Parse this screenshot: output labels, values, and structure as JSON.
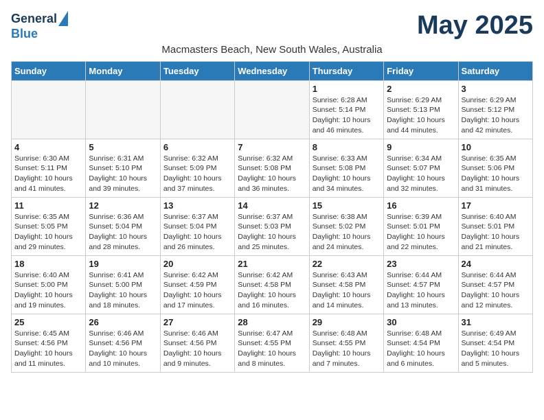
{
  "header": {
    "logo_line1": "General",
    "logo_line2": "Blue",
    "month": "May 2025",
    "subtitle": "Macmasters Beach, New South Wales, Australia"
  },
  "weekdays": [
    "Sunday",
    "Monday",
    "Tuesday",
    "Wednesday",
    "Thursday",
    "Friday",
    "Saturday"
  ],
  "weeks": [
    [
      {
        "day": "",
        "info": ""
      },
      {
        "day": "",
        "info": ""
      },
      {
        "day": "",
        "info": ""
      },
      {
        "day": "",
        "info": ""
      },
      {
        "day": "1",
        "info": "Sunrise: 6:28 AM\nSunset: 5:14 PM\nDaylight: 10 hours\nand 46 minutes."
      },
      {
        "day": "2",
        "info": "Sunrise: 6:29 AM\nSunset: 5:13 PM\nDaylight: 10 hours\nand 44 minutes."
      },
      {
        "day": "3",
        "info": "Sunrise: 6:29 AM\nSunset: 5:12 PM\nDaylight: 10 hours\nand 42 minutes."
      }
    ],
    [
      {
        "day": "4",
        "info": "Sunrise: 6:30 AM\nSunset: 5:11 PM\nDaylight: 10 hours\nand 41 minutes."
      },
      {
        "day": "5",
        "info": "Sunrise: 6:31 AM\nSunset: 5:10 PM\nDaylight: 10 hours\nand 39 minutes."
      },
      {
        "day": "6",
        "info": "Sunrise: 6:32 AM\nSunset: 5:09 PM\nDaylight: 10 hours\nand 37 minutes."
      },
      {
        "day": "7",
        "info": "Sunrise: 6:32 AM\nSunset: 5:08 PM\nDaylight: 10 hours\nand 36 minutes."
      },
      {
        "day": "8",
        "info": "Sunrise: 6:33 AM\nSunset: 5:08 PM\nDaylight: 10 hours\nand 34 minutes."
      },
      {
        "day": "9",
        "info": "Sunrise: 6:34 AM\nSunset: 5:07 PM\nDaylight: 10 hours\nand 32 minutes."
      },
      {
        "day": "10",
        "info": "Sunrise: 6:35 AM\nSunset: 5:06 PM\nDaylight: 10 hours\nand 31 minutes."
      }
    ],
    [
      {
        "day": "11",
        "info": "Sunrise: 6:35 AM\nSunset: 5:05 PM\nDaylight: 10 hours\nand 29 minutes."
      },
      {
        "day": "12",
        "info": "Sunrise: 6:36 AM\nSunset: 5:04 PM\nDaylight: 10 hours\nand 28 minutes."
      },
      {
        "day": "13",
        "info": "Sunrise: 6:37 AM\nSunset: 5:04 PM\nDaylight: 10 hours\nand 26 minutes."
      },
      {
        "day": "14",
        "info": "Sunrise: 6:37 AM\nSunset: 5:03 PM\nDaylight: 10 hours\nand 25 minutes."
      },
      {
        "day": "15",
        "info": "Sunrise: 6:38 AM\nSunset: 5:02 PM\nDaylight: 10 hours\nand 24 minutes."
      },
      {
        "day": "16",
        "info": "Sunrise: 6:39 AM\nSunset: 5:01 PM\nDaylight: 10 hours\nand 22 minutes."
      },
      {
        "day": "17",
        "info": "Sunrise: 6:40 AM\nSunset: 5:01 PM\nDaylight: 10 hours\nand 21 minutes."
      }
    ],
    [
      {
        "day": "18",
        "info": "Sunrise: 6:40 AM\nSunset: 5:00 PM\nDaylight: 10 hours\nand 19 minutes."
      },
      {
        "day": "19",
        "info": "Sunrise: 6:41 AM\nSunset: 5:00 PM\nDaylight: 10 hours\nand 18 minutes."
      },
      {
        "day": "20",
        "info": "Sunrise: 6:42 AM\nSunset: 4:59 PM\nDaylight: 10 hours\nand 17 minutes."
      },
      {
        "day": "21",
        "info": "Sunrise: 6:42 AM\nSunset: 4:58 PM\nDaylight: 10 hours\nand 16 minutes."
      },
      {
        "day": "22",
        "info": "Sunrise: 6:43 AM\nSunset: 4:58 PM\nDaylight: 10 hours\nand 14 minutes."
      },
      {
        "day": "23",
        "info": "Sunrise: 6:44 AM\nSunset: 4:57 PM\nDaylight: 10 hours\nand 13 minutes."
      },
      {
        "day": "24",
        "info": "Sunrise: 6:44 AM\nSunset: 4:57 PM\nDaylight: 10 hours\nand 12 minutes."
      }
    ],
    [
      {
        "day": "25",
        "info": "Sunrise: 6:45 AM\nSunset: 4:56 PM\nDaylight: 10 hours\nand 11 minutes."
      },
      {
        "day": "26",
        "info": "Sunrise: 6:46 AM\nSunset: 4:56 PM\nDaylight: 10 hours\nand 10 minutes."
      },
      {
        "day": "27",
        "info": "Sunrise: 6:46 AM\nSunset: 4:56 PM\nDaylight: 10 hours\nand 9 minutes."
      },
      {
        "day": "28",
        "info": "Sunrise: 6:47 AM\nSunset: 4:55 PM\nDaylight: 10 hours\nand 8 minutes."
      },
      {
        "day": "29",
        "info": "Sunrise: 6:48 AM\nSunset: 4:55 PM\nDaylight: 10 hours\nand 7 minutes."
      },
      {
        "day": "30",
        "info": "Sunrise: 6:48 AM\nSunset: 4:54 PM\nDaylight: 10 hours\nand 6 minutes."
      },
      {
        "day": "31",
        "info": "Sunrise: 6:49 AM\nSunset: 4:54 PM\nDaylight: 10 hours\nand 5 minutes."
      }
    ]
  ]
}
